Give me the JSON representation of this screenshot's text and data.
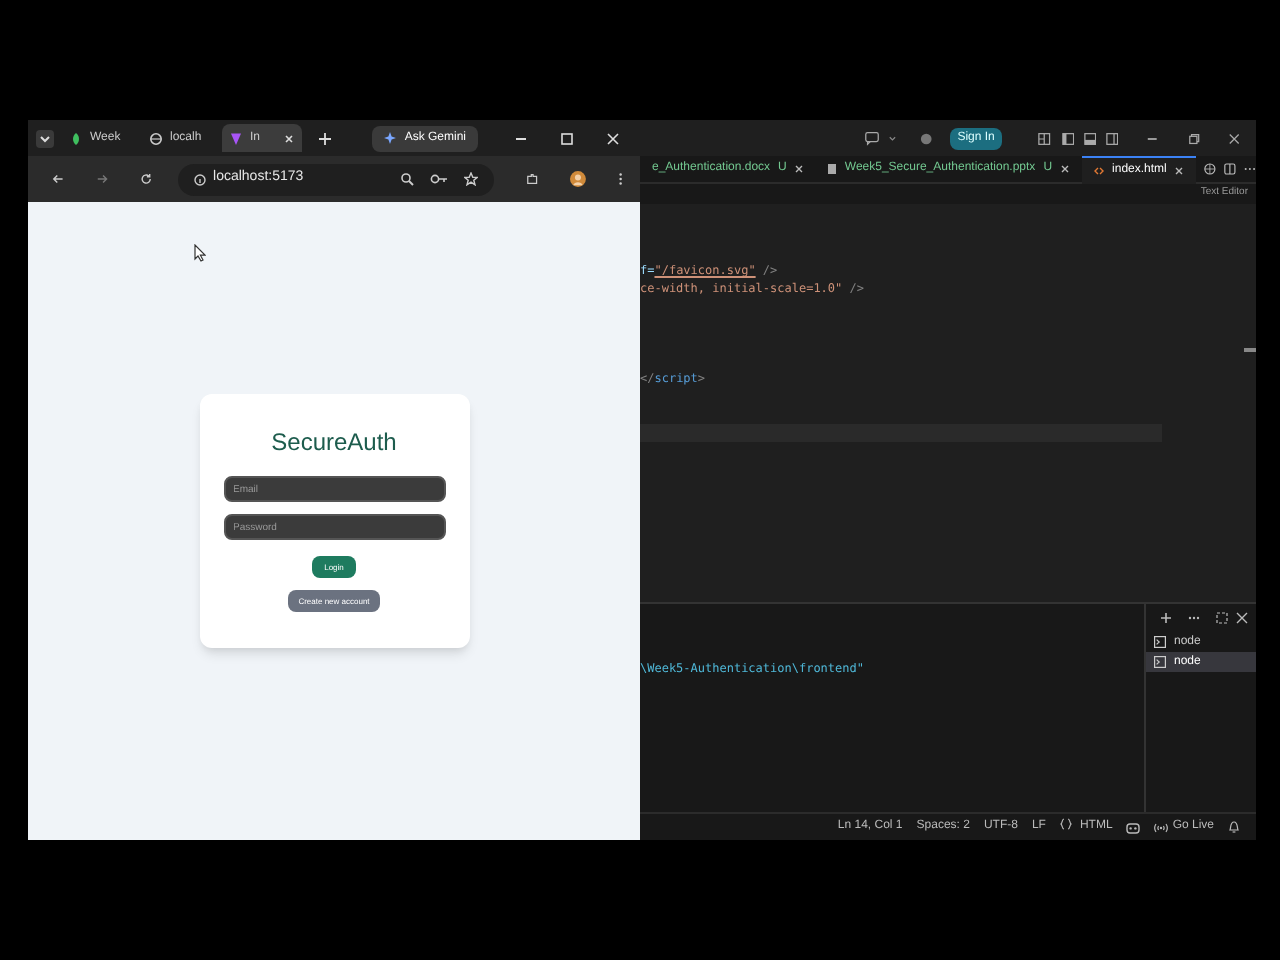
{
  "browser": {
    "tabs": [
      {
        "label": "Week",
        "selected": false
      },
      {
        "label": "localh",
        "selected": false
      },
      {
        "label": "In",
        "selected": true
      }
    ],
    "ask_button": "Ask Gemini",
    "address": "localhost:5173",
    "page": {
      "title": "SecureAuth",
      "fields": [
        {
          "placeholder": "Email"
        },
        {
          "placeholder": "Password"
        }
      ],
      "buttons": [
        {
          "label": "Login",
          "kind": "primary"
        },
        {
          "label": "Create new account",
          "kind": "secondary"
        }
      ]
    }
  },
  "editor": {
    "sign_in": "Sign In",
    "tabs": [
      {
        "label": "e_Authentication.docx",
        "badge": "U",
        "selected": false
      },
      {
        "label": "Week5_Secure_Authentication.pptx",
        "badge": "U",
        "selected": false
      },
      {
        "label": "index.html",
        "selected": true
      }
    ],
    "view_label": "Text Editor",
    "lines": [
      {
        "kind": "blank",
        "current": false
      },
      {
        "kind": "blank",
        "current": false
      },
      {
        "kind": "blank",
        "current": false
      },
      {
        "kind": "code",
        "current": false,
        "tokens": [
          {
            "text": "f=",
            "kind": "attr"
          },
          {
            "text": "\"/favicon.svg\"",
            "kind": "link"
          },
          {
            "text": " />",
            "kind": "punct"
          }
        ]
      },
      {
        "kind": "code",
        "current": false,
        "tokens": [
          {
            "text": "ce-width, initial-scale=1.0\"",
            "kind": "string"
          },
          {
            "text": " />",
            "kind": "punct"
          }
        ]
      },
      {
        "kind": "blank",
        "current": false
      },
      {
        "kind": "blank",
        "current": false
      },
      {
        "kind": "blank",
        "current": false
      },
      {
        "kind": "blank",
        "current": false
      },
      {
        "kind": "code",
        "current": false,
        "tokens": [
          {
            "text": "</",
            "kind": "punct"
          },
          {
            "text": "script",
            "kind": "tag"
          },
          {
            "text": ">",
            "kind": "punct"
          }
        ]
      },
      {
        "kind": "blank",
        "current": false
      },
      {
        "kind": "blank",
        "current": false
      },
      {
        "kind": "blank",
        "current": true
      }
    ],
    "terminal_line": "\\Week5-Authentication\\frontend\"",
    "terminals": [
      {
        "label": "node",
        "selected": false
      },
      {
        "label": "node",
        "selected": true
      }
    ],
    "status": [
      {
        "text": "Ln 14, Col 1",
        "kind": "text"
      },
      {
        "text": "Spaces: 2",
        "kind": "text"
      },
      {
        "text": "UTF-8",
        "kind": "text"
      },
      {
        "text": "LF",
        "kind": "text"
      },
      {
        "text": "HTML",
        "kind": "braces"
      },
      {
        "kind": "copilot"
      },
      {
        "text": "Go Live",
        "kind": "live"
      },
      {
        "kind": "bell"
      }
    ]
  }
}
